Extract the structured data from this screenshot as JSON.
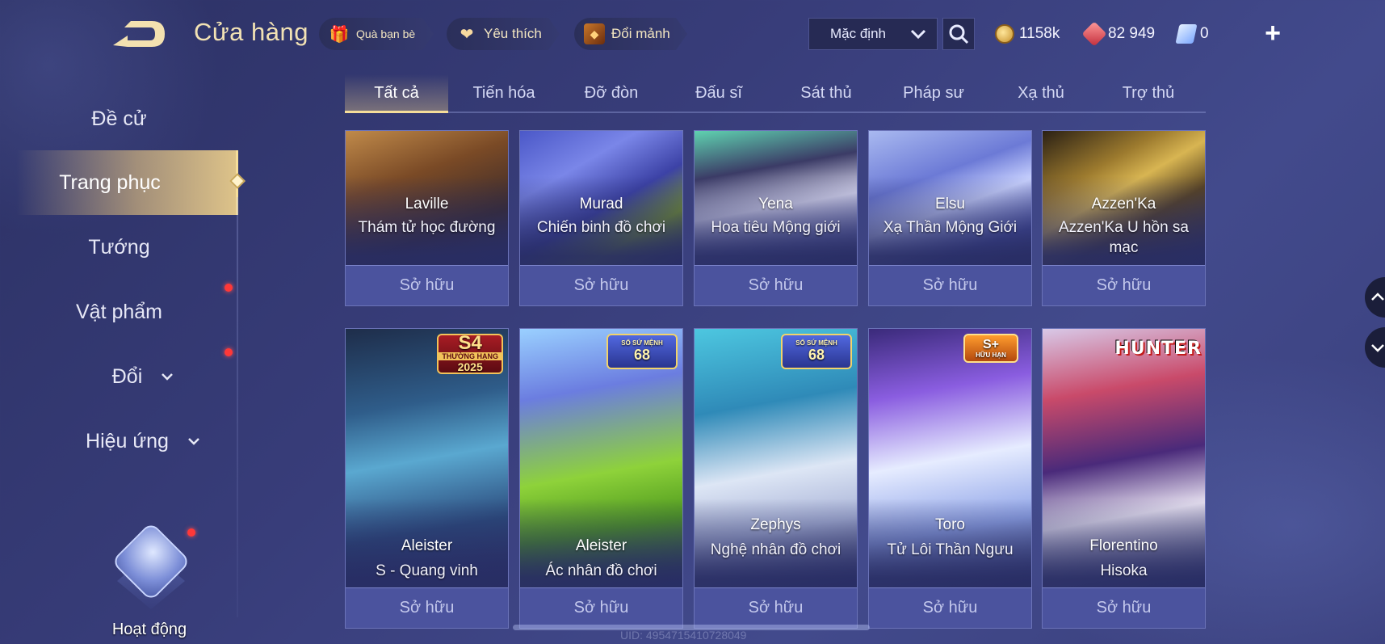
{
  "header": {
    "title": "Cửa hàng",
    "gift_label": "Quà bạn bè",
    "favorite_label": "Yêu thích",
    "shard_label": "Đổi mảnh",
    "sort_value": "Mặc định",
    "currencies": {
      "gold": "1158k",
      "gems": "82 949",
      "tickets": "0"
    },
    "add_label": "+"
  },
  "sidebar": {
    "items": [
      {
        "label": "Đề cử"
      },
      {
        "label": "Trang phục"
      },
      {
        "label": "Tướng"
      },
      {
        "label": "Vật phẩm"
      },
      {
        "label": "Đổi"
      },
      {
        "label": "Hiệu ứng"
      }
    ],
    "activity_label": "Hoạt động"
  },
  "tabs": [
    "Tất cả",
    "Tiến hóa",
    "Đỡ đòn",
    "Đấu sĩ",
    "Sát thủ",
    "Pháp sư",
    "Xạ thủ",
    "Trợ thủ"
  ],
  "cards_row1": [
    {
      "hero": "Laville",
      "skin": "Thám tử học đường",
      "status": "Sở hữu"
    },
    {
      "hero": "Murad",
      "skin": "Chiến binh đồ chơi",
      "status": "Sở hữu"
    },
    {
      "hero": "Yena",
      "skin": "Hoa tiêu Mộng giới",
      "status": "Sở hữu"
    },
    {
      "hero": "Elsu",
      "skin": "Xạ Thần Mộng Giới",
      "status": "Sở hữu"
    },
    {
      "hero": "Azzen'Ka",
      "skin": "Azzen'Ka U hồn sa mạc",
      "status": "Sở hữu"
    }
  ],
  "cards_row2": [
    {
      "hero": "Aleister",
      "skin": "S - Quang vinh",
      "status": "Sở hữu",
      "badge": {
        "l1": "S4",
        "l2": "THƯỜNG HẠNG",
        "l3": "2025"
      }
    },
    {
      "hero": "Aleister",
      "skin": "Ác nhân đồ chơi",
      "status": "Sở hữu",
      "badge": {
        "l1": "SỔ SỨ MỆNH",
        "l2": "68"
      }
    },
    {
      "hero": "Zephys",
      "skin": "Nghệ nhân đồ chơi",
      "status": "Sở hữu",
      "badge": {
        "l1": "SỔ SỨ MỆNH",
        "l2": "68"
      }
    },
    {
      "hero": "Toro",
      "skin": "Tử Lôi Thần Ngưu",
      "status": "Sở hữu",
      "badge": {
        "l1": "S+",
        "l2": "HỮU HẠN"
      }
    },
    {
      "hero": "Florentino",
      "skin": "Hisoka",
      "status": "Sở hữu",
      "badge": {
        "l1": "HUNTER"
      }
    }
  ],
  "footer": {
    "uid": "UID: 4954715410728049"
  },
  "colors": {
    "accent_gold": "#f5dd9a",
    "bg": "#383d7a",
    "own_button": "#4b539e",
    "notify": "#ff3838"
  }
}
